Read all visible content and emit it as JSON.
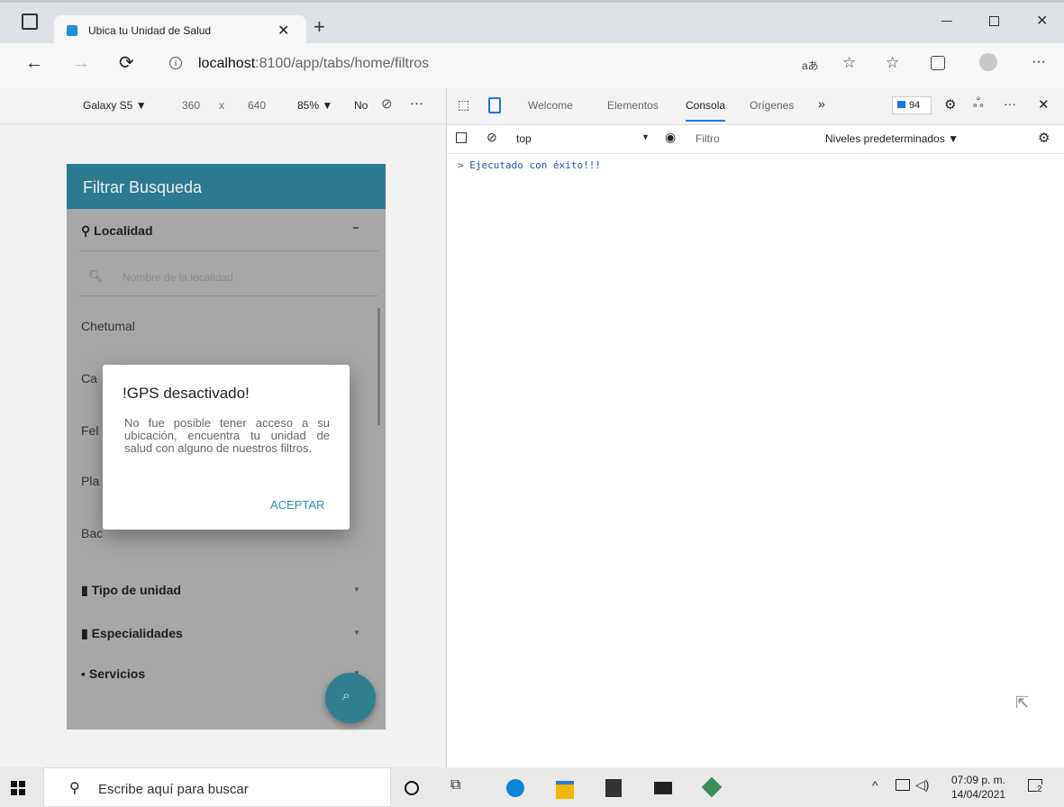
{
  "browser": {
    "tab_title": "Ubica tu Unidad de Salud",
    "url_host": "localhost",
    "url_rest": ":8100/app/tabs/home/filtros",
    "window_icons": [
      "tab-actions-icon",
      "minimize-icon",
      "restore-icon",
      "close-icon"
    ]
  },
  "device_toolbar": {
    "device": "Galaxy S5 ▼",
    "width": "360",
    "x": "x",
    "height": "640",
    "zoom": "85% ▼",
    "throttle": "No"
  },
  "devtools": {
    "tabs": [
      "Welcome",
      "Elementos",
      "Consola",
      "Orígenes"
    ],
    "selected_tab": "Consola",
    "issues_count": "94",
    "context": "top",
    "filter_placeholder": "Filtro",
    "levels": "Niveles predeterminados ▼",
    "console_line": "> Ejecutado con éxito!!!"
  },
  "app": {
    "header_title": "Filtrar Busqueda",
    "sections": {
      "localidad": "Localidad",
      "tipo": "Tipo de unidad",
      "especialidades": "Especialidades",
      "servicios": "Servicios"
    },
    "search_placeholder": "Nombre de la localidad",
    "list": [
      "Chetumal",
      "Ca",
      "Fel",
      "Pla",
      "Bac"
    ],
    "dialog": {
      "title": "!GPS desactivado!",
      "body": "No fue posible tener acceso a su ubicación, encuentra tu unidad de salud con alguno de nuestros filtros.",
      "button": "ACEPTAR"
    }
  },
  "taskbar": {
    "search_placeholder": "Escribe aquí para buscar",
    "time": "07:09 p. m.",
    "date": "14/04/2021",
    "notifications": "2"
  },
  "colors": {
    "teal_header": "#2c7a8f",
    "accent_blue": "#1a73e8"
  }
}
